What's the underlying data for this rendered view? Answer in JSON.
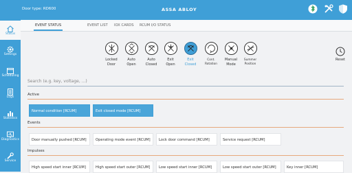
{
  "topbar": {
    "door_type": "Door type: RD600",
    "brand": "ASSA ABLOY",
    "icons": [
      "bluetooth-lock-icon",
      "tools-icon",
      "shield-icon"
    ]
  },
  "sidebar": {
    "items": [
      {
        "label": "Status",
        "icon": "home-icon"
      },
      {
        "label": "Settings",
        "icon": "gear-icon"
      },
      {
        "label": "Scheduling",
        "icon": "calendar-icon"
      },
      {
        "label": "Logs",
        "icon": "document-icon"
      },
      {
        "label": "Statistics",
        "icon": "bar-chart-icon"
      },
      {
        "label": "Diagnostics",
        "icon": "diagnostics-icon"
      },
      {
        "label": "Service",
        "icon": "wrench-icon"
      }
    ]
  },
  "tabs": [
    "EVENT STATUS",
    "EVENT LIST",
    "IOX CARDS",
    "RCUM I/O STATUS"
  ],
  "modes": [
    {
      "line1": "Locked",
      "line2": "Door"
    },
    {
      "line1": "Auto",
      "line2": "Open"
    },
    {
      "line1": "Auto",
      "line2": "Closed"
    },
    {
      "line1": "Exit",
      "line2": "Open"
    },
    {
      "line1": "Exit",
      "line2": "Closed"
    },
    {
      "line1": "Cont.",
      "line2": "Rotation"
    },
    {
      "line1": "Manual",
      "line2": "Mode"
    },
    {
      "line1": "Summer",
      "line2": "Position"
    }
  ],
  "reset_label": "Reset",
  "search_placeholder": "Search (e.g. key, voltage, ...)",
  "sections": {
    "active": {
      "title": "Active",
      "cards": [
        "Normal condition [RCUM]",
        "Exit closed mode [RCUM]"
      ]
    },
    "events": {
      "title": "Events",
      "cards": [
        "Door manually pushed [RCUM]",
        "Operating mode event [RCUM]",
        "Lock door command [RCUM]",
        "Service request [RCUM]"
      ]
    },
    "impulses": {
      "title": "Impulses",
      "cards": [
        "High speed start inner [RCUM]",
        "High speed start outer [RCUM]",
        "Low speed start inner [RCUM]",
        "Low speed start outer [RCUM]",
        "Key inner [RCUM]"
      ]
    }
  },
  "colors": {
    "accent": "#3f9fd7",
    "section_rule": "#e6a87c",
    "active_card": "#4aa5d9"
  }
}
